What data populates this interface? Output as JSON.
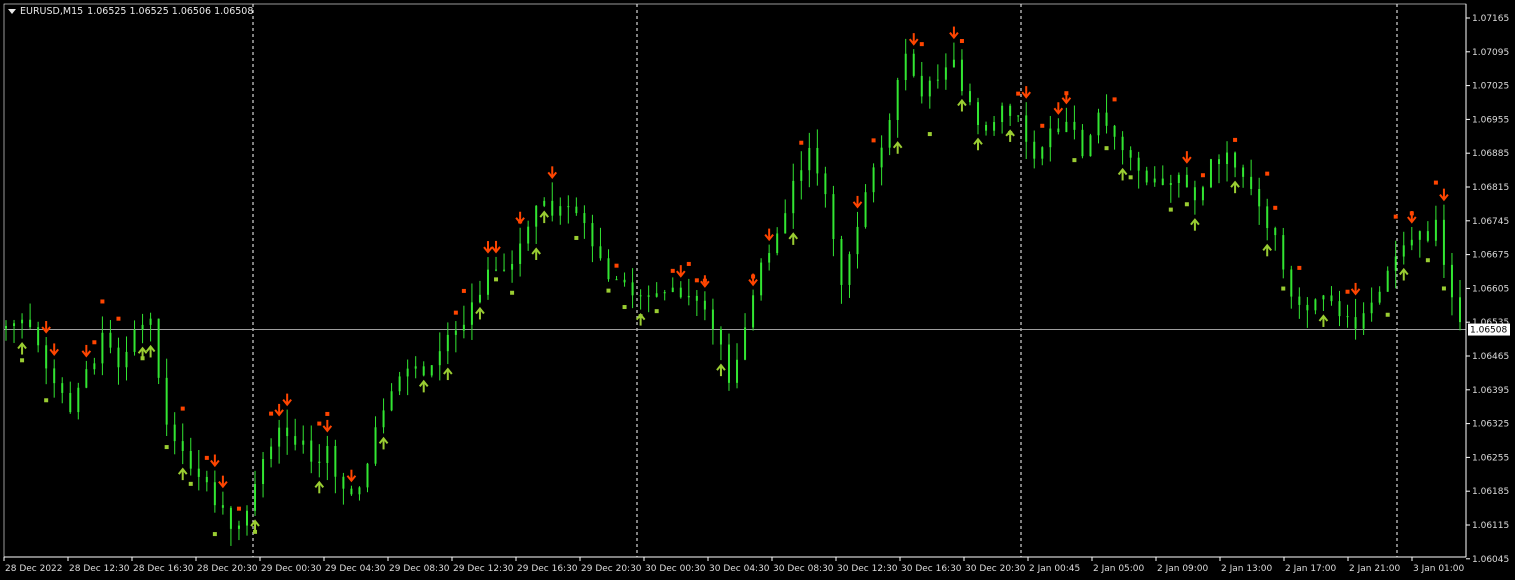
{
  "header": {
    "symbol": "EURUSD,M15",
    "ohlc": "1.06525 1.06525 1.06506 1.06508"
  },
  "colors": {
    "background": "#000000",
    "candles": "#32e632",
    "up_arrow": "#9acd32",
    "down_arrow": "#ff4500",
    "axis": "#ffffff",
    "grid_separator": "#ffffff",
    "current_price_line": "#b4b4b4"
  },
  "price_axis": {
    "labels": [
      "1.07165",
      "1.07095",
      "1.07025",
      "1.06955",
      "1.06885",
      "1.06815",
      "1.06745",
      "1.06675",
      "1.06605",
      "1.06535",
      "1.06465",
      "1.06395",
      "1.06325",
      "1.06255",
      "1.06185",
      "1.06115",
      "1.06045"
    ],
    "current_price": "1.06508"
  },
  "time_axis": {
    "labels": [
      "28 Dec 2022",
      "28 Dec 12:30",
      "28 Dec 16:30",
      "28 Dec 20:30",
      "29 Dec 00:30",
      "29 Dec 04:30",
      "29 Dec 08:30",
      "29 Dec 12:30",
      "29 Dec 16:30",
      "29 Dec 20:30",
      "30 Dec 00:30",
      "30 Dec 04:30",
      "30 Dec 08:30",
      "30 Dec 12:30",
      "30 Dec 16:30",
      "30 Dec 20:30",
      "2 Jan 00:45",
      "2 Jan 05:00",
      "2 Jan 09:00",
      "2 Jan 13:00",
      "2 Jan 17:00",
      "2 Jan 21:00",
      "3 Jan 01:00"
    ]
  },
  "chart_data": {
    "type": "candlestick",
    "symbol": "EURUSD",
    "timeframe": "M15",
    "ylim": [
      1.06035,
      1.07185
    ],
    "day_separators": [
      "28 Dec 23:45",
      "29 Dec 23:45",
      "30 Dec 23:45",
      "2 Jan 23:45"
    ],
    "current_price": 1.06508,
    "close_path": [
      [
        0,
        1.0651
      ],
      [
        2,
        1.0652
      ],
      [
        4,
        1.0648
      ],
      [
        6,
        1.0638
      ],
      [
        8,
        1.0635
      ],
      [
        10,
        1.0641
      ],
      [
        12,
        1.065
      ],
      [
        14,
        1.0644
      ],
      [
        16,
        1.0649
      ],
      [
        18,
        1.0652
      ],
      [
        20,
        1.063
      ],
      [
        22,
        1.0625
      ],
      [
        24,
        1.062
      ],
      [
        26,
        1.0616
      ],
      [
        28,
        1.061
      ],
      [
        30,
        1.0612
      ],
      [
        32,
        1.0624
      ],
      [
        34,
        1.063
      ],
      [
        36,
        1.0628
      ],
      [
        38,
        1.0624
      ],
      [
        40,
        1.0625
      ],
      [
        42,
        1.0617
      ],
      [
        44,
        1.0618
      ],
      [
        46,
        1.063
      ],
      [
        48,
        1.0637
      ],
      [
        50,
        1.0643
      ],
      [
        52,
        1.0642
      ],
      [
        54,
        1.0646
      ],
      [
        56,
        1.065
      ],
      [
        58,
        1.0656
      ],
      [
        60,
        1.0662
      ],
      [
        62,
        1.0664
      ],
      [
        64,
        1.0668
      ],
      [
        66,
        1.0678
      ],
      [
        68,
        1.0675
      ],
      [
        70,
        1.0678
      ],
      [
        72,
        1.0673
      ],
      [
        74,
        1.0664
      ],
      [
        76,
        1.066
      ],
      [
        78,
        1.0658
      ],
      [
        80,
        1.0656
      ],
      [
        82,
        1.0659
      ],
      [
        84,
        1.0658
      ],
      [
        86,
        1.0657
      ],
      [
        88,
        1.0652
      ],
      [
        90,
        1.0641
      ],
      [
        92,
        1.065
      ],
      [
        94,
        1.0664
      ],
      [
        96,
        1.067
      ],
      [
        98,
        1.068
      ],
      [
        100,
        1.0688
      ],
      [
        102,
        1.068
      ],
      [
        104,
        1.066
      ],
      [
        106,
        1.0673
      ],
      [
        108,
        1.0685
      ],
      [
        110,
        1.0695
      ],
      [
        112,
        1.0708
      ],
      [
        114,
        1.07
      ],
      [
        116,
        1.0702
      ],
      [
        118,
        1.0706
      ],
      [
        120,
        1.0698
      ],
      [
        122,
        1.0692
      ],
      [
        124,
        1.0696
      ],
      [
        126,
        1.0694
      ],
      [
        128,
        1.0688
      ],
      [
        130,
        1.0692
      ],
      [
        132,
        1.0695
      ],
      [
        134,
        1.0688
      ],
      [
        136,
        1.0696
      ],
      [
        138,
        1.0691
      ],
      [
        140,
        1.0686
      ],
      [
        142,
        1.0682
      ],
      [
        144,
        1.068
      ],
      [
        146,
        1.0682
      ],
      [
        148,
        1.0678
      ],
      [
        150,
        1.0685
      ],
      [
        152,
        1.0686
      ],
      [
        154,
        1.0681
      ],
      [
        156,
        1.0676
      ],
      [
        158,
        1.067
      ],
      [
        160,
        1.0656
      ],
      [
        162,
        1.0655
      ],
      [
        164,
        1.0658
      ],
      [
        166,
        1.0653
      ],
      [
        168,
        1.0652
      ],
      [
        170,
        1.0656
      ],
      [
        172,
        1.0663
      ],
      [
        174,
        1.0668
      ],
      [
        176,
        1.067
      ],
      [
        178,
        1.0672
      ],
      [
        180,
        1.0658
      ],
      [
        181,
        1.06508
      ]
    ]
  }
}
